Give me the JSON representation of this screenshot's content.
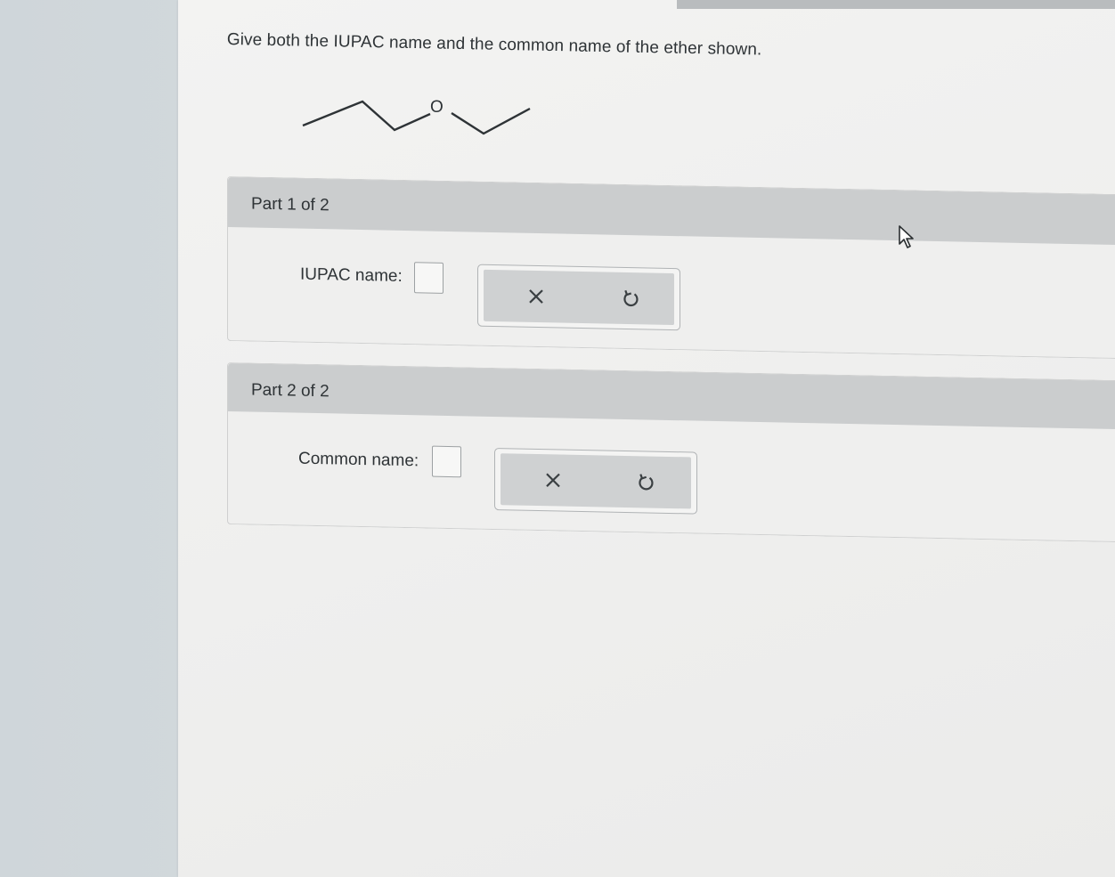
{
  "question": {
    "text": "Give both the IUPAC name and the common name of the ether shown.",
    "oxygen_label": "O"
  },
  "parts": [
    {
      "title": "Part 1 of 2",
      "field_label": "IUPAC name:",
      "answer_value": "",
      "clear_icon": "x-icon",
      "undo_icon": "undo-icon"
    },
    {
      "title": "Part 2 of 2",
      "field_label": "Common name:",
      "answer_value": "",
      "clear_icon": "x-icon",
      "undo_icon": "undo-icon"
    }
  ],
  "colors": {
    "text": "#2e3336",
    "header_bg": "#cbcdce",
    "tool_bg": "#cfd1d2",
    "page_bg": "#efefee"
  }
}
